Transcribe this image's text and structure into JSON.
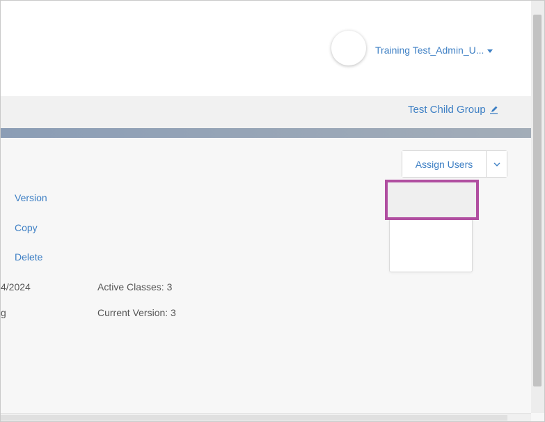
{
  "header": {
    "user_name": "Training Test_Admin_U..."
  },
  "group": {
    "name": "Test Child Group"
  },
  "actions": {
    "assign_users_label": "Assign Users",
    "menu_items": [
      "Version",
      "Copy",
      "Delete"
    ]
  },
  "details": {
    "date_fragment": "4/2024",
    "status_fragment": "g",
    "active_classes": "Active Classes: 3",
    "current_version": "Current Version: 3"
  },
  "colors": {
    "link": "#3d7fc4",
    "highlight_border": "#b04ea0",
    "stripe": "#8b9db5"
  }
}
